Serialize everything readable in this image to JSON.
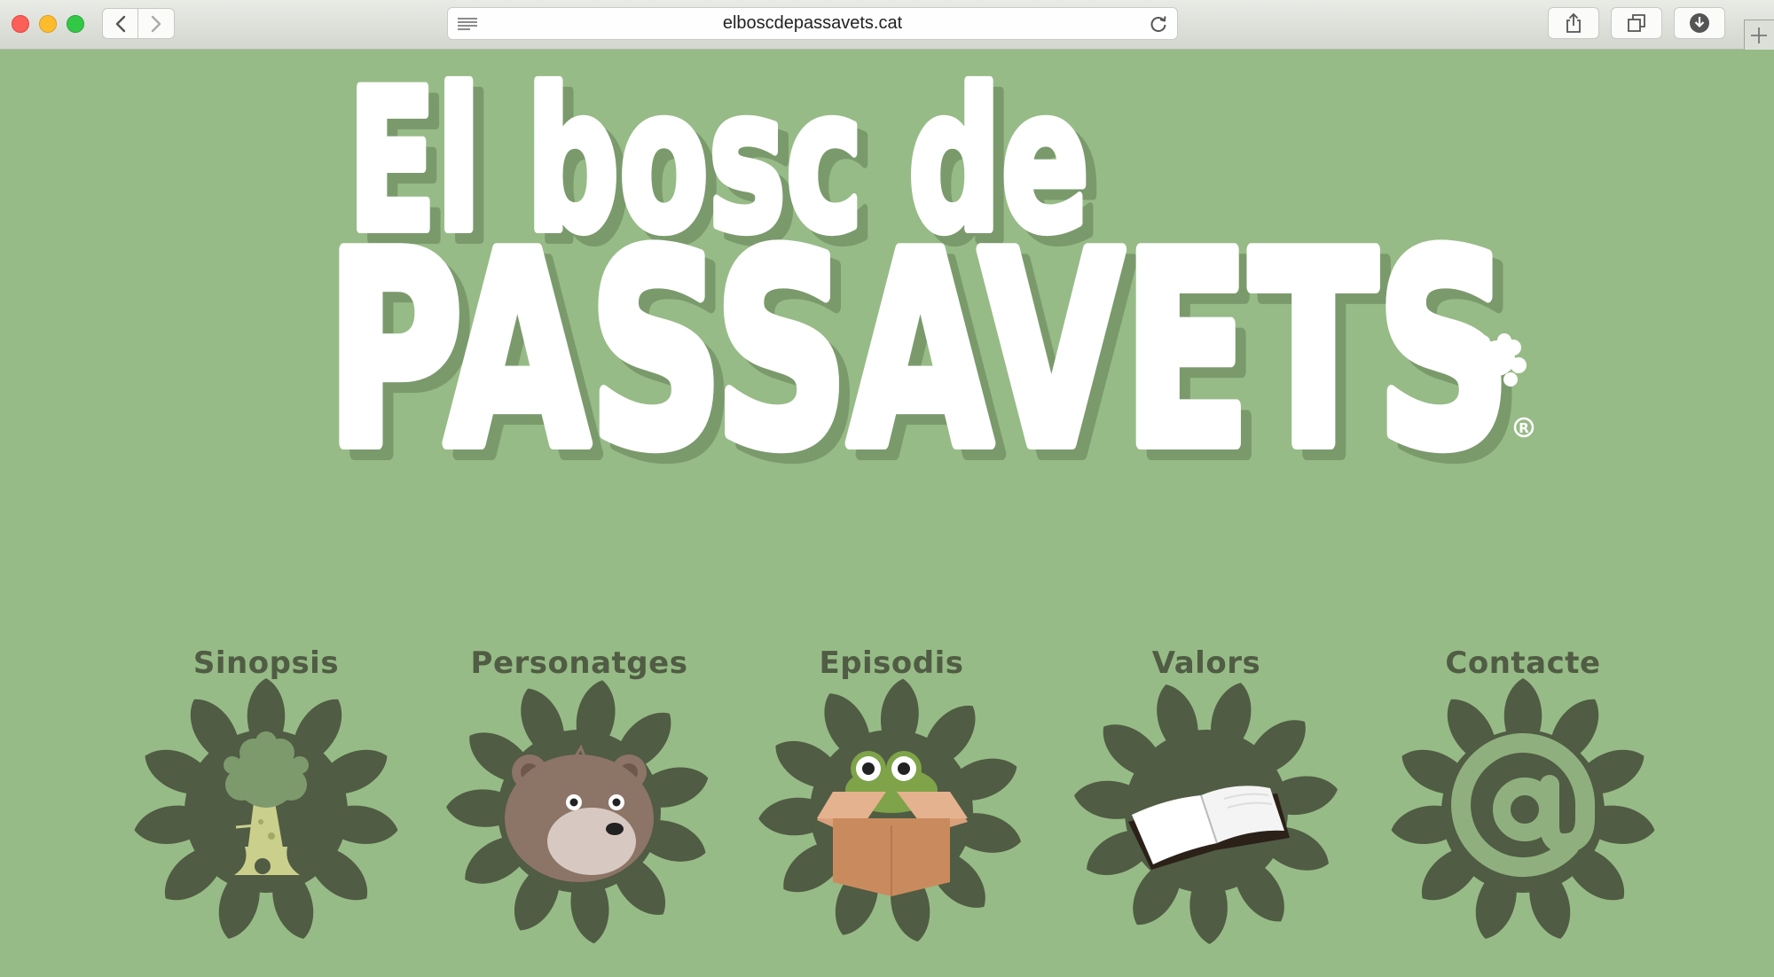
{
  "browser": {
    "url": "elboscdepassavets.cat",
    "icons": {
      "back": "chevron-left-icon",
      "forward": "chevron-right-icon",
      "reader": "reader-lines-icon",
      "reload": "reload-icon",
      "share": "share-icon",
      "tabs": "tabs-overview-icon",
      "download": "download-icon",
      "new_tab": "plus-icon"
    }
  },
  "logo": {
    "line1": "El bosc de",
    "line2": "PASSAVETS",
    "registered": "R"
  },
  "nav": [
    {
      "label": "Sinopsis",
      "icon": "tree-icon"
    },
    {
      "label": "Personatges",
      "icon": "bear-icon"
    },
    {
      "label": "Episodis",
      "icon": "frog-in-box-icon"
    },
    {
      "label": "Valors",
      "icon": "open-book-icon"
    },
    {
      "label": "Contacte",
      "icon": "at-sign-icon"
    }
  ],
  "colors": {
    "background": "#97bb87",
    "flower": "#505c43",
    "logo_text": "#ffffff",
    "logo_shadow": "#7a9a6c"
  }
}
